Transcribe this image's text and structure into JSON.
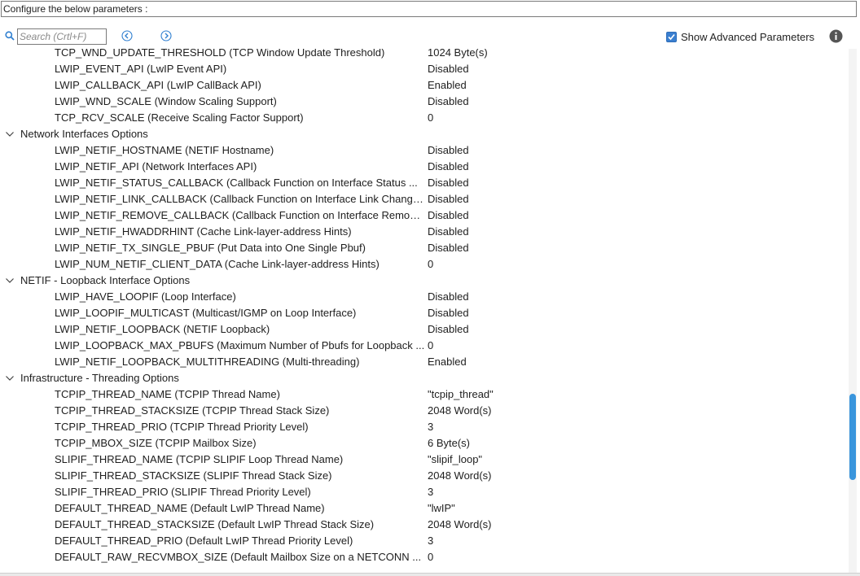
{
  "header": {
    "title": "Configure the below parameters :"
  },
  "toolbar": {
    "search_placeholder": "Search (Crtl+F)",
    "show_advanced_label": "Show Advanced Parameters",
    "show_advanced_checked": true,
    "accent_color": "#3a95dc"
  },
  "tree": {
    "rows": [
      {
        "type": "param",
        "name": "TCP_WND_UPDATE_THRESHOLD (TCP Window Update Threshold)",
        "value": "1024 Byte(s)"
      },
      {
        "type": "param",
        "name": "LWIP_EVENT_API (LwIP Event API)",
        "value": "Disabled"
      },
      {
        "type": "param",
        "name": "LWIP_CALLBACK_API (LwIP CallBack API)",
        "value": "Enabled"
      },
      {
        "type": "param",
        "name": "LWIP_WND_SCALE (Window Scaling Support)",
        "value": "Disabled"
      },
      {
        "type": "param",
        "name": "TCP_RCV_SCALE (Receive Scaling Factor Support)",
        "value": "0"
      },
      {
        "type": "group",
        "name": "Network Interfaces Options"
      },
      {
        "type": "param",
        "name": "LWIP_NETIF_HOSTNAME (NETIF Hostname)",
        "value": "Disabled"
      },
      {
        "type": "param",
        "name": "LWIP_NETIF_API (Network Interfaces API)",
        "value": "Disabled"
      },
      {
        "type": "param",
        "name": "LWIP_NETIF_STATUS_CALLBACK (Callback Function on Interface Status ...",
        "value": "Disabled"
      },
      {
        "type": "param",
        "name": "LWIP_NETIF_LINK_CALLBACK (Callback Function on Interface Link Changes)",
        "value": "Disabled"
      },
      {
        "type": "param",
        "name": "LWIP_NETIF_REMOVE_CALLBACK (Callback Function on Interface Removal)",
        "value": "Disabled"
      },
      {
        "type": "param",
        "name": "LWIP_NETIF_HWADDRHINT (Cache Link-layer-address Hints)",
        "value": "Disabled"
      },
      {
        "type": "param",
        "name": "LWIP_NETIF_TX_SINGLE_PBUF (Put Data into One Single Pbuf)",
        "value": "Disabled"
      },
      {
        "type": "param",
        "name": "LWIP_NUM_NETIF_CLIENT_DATA (Cache Link-layer-address Hints)",
        "value": "0"
      },
      {
        "type": "group",
        "name": "NETIF - Loopback Interface Options"
      },
      {
        "type": "param",
        "name": "LWIP_HAVE_LOOPIF (Loop Interface)",
        "value": "Disabled"
      },
      {
        "type": "param",
        "name": "LWIP_LOOPIF_MULTICAST (Multicast/IGMP on Loop Interface)",
        "value": "Disabled"
      },
      {
        "type": "param",
        "name": "LWIP_NETIF_LOOPBACK (NETIF Loopback)",
        "value": "Disabled"
      },
      {
        "type": "param",
        "name": "LWIP_LOOPBACK_MAX_PBUFS (Maximum Number of Pbufs for Loopback ...",
        "value": "0"
      },
      {
        "type": "param",
        "name": "LWIP_NETIF_LOOPBACK_MULTITHREADING (Multi-threading)",
        "value": "Enabled"
      },
      {
        "type": "group",
        "name": "Infrastructure - Threading Options"
      },
      {
        "type": "param",
        "name": "TCPIP_THREAD_NAME (TCPIP Thread Name)",
        "value": "\"tcpip_thread\""
      },
      {
        "type": "param",
        "name": "TCPIP_THREAD_STACKSIZE (TCPIP Thread Stack Size)",
        "value": "2048 Word(s)"
      },
      {
        "type": "param",
        "name": "TCPIP_THREAD_PRIO (TCPIP Thread Priority Level)",
        "value": "3"
      },
      {
        "type": "param",
        "name": "TCPIP_MBOX_SIZE (TCPIP Mailbox Size)",
        "value": "6 Byte(s)"
      },
      {
        "type": "param",
        "name": "SLIPIF_THREAD_NAME (TCPIP SLIPIF Loop Thread Name)",
        "value": "\"slipif_loop\""
      },
      {
        "type": "param",
        "name": "SLIPIF_THREAD_STACKSIZE (SLIPIF Thread Stack Size)",
        "value": "2048 Word(s)"
      },
      {
        "type": "param",
        "name": "SLIPIF_THREAD_PRIO (SLIPIF Thread Priority Level)",
        "value": "3"
      },
      {
        "type": "param",
        "name": "DEFAULT_THREAD_NAME (Default LwIP Thread Name)",
        "value": "\"lwIP\""
      },
      {
        "type": "param",
        "name": "DEFAULT_THREAD_STACKSIZE (Default LwIP Thread Stack Size)",
        "value": "2048 Word(s)"
      },
      {
        "type": "param",
        "name": "DEFAULT_THREAD_PRIO (Default LwIP Thread Priority Level)",
        "value": "3"
      },
      {
        "type": "param",
        "name": "DEFAULT_RAW_RECVMBOX_SIZE (Default Mailbox Size on a NETCONN ...",
        "value": "0"
      }
    ]
  }
}
